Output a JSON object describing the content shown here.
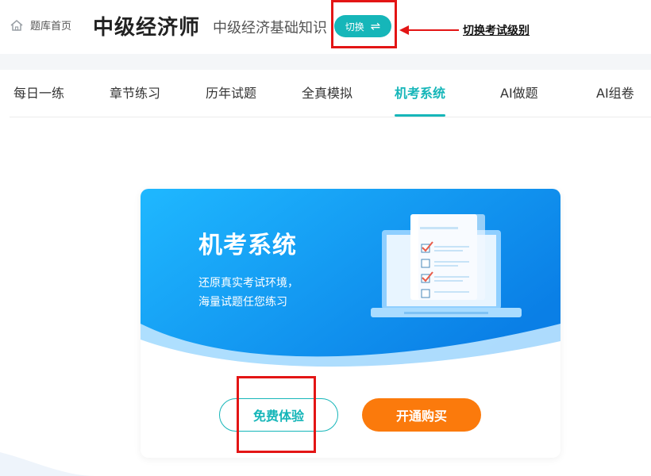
{
  "header": {
    "home_label": "题库首页",
    "exam_title": "中级经济师",
    "subject": "中级经济基础知识",
    "switch_label": "切换",
    "switch_icon": "⇌"
  },
  "annotation": {
    "switch_note": "切换考试级别"
  },
  "tabs": [
    {
      "label": "每日一练"
    },
    {
      "label": "章节练习"
    },
    {
      "label": "历年试题"
    },
    {
      "label": "全真模拟"
    },
    {
      "label": "机考系统",
      "active": true
    },
    {
      "label": "AI做题"
    },
    {
      "label": "AI组卷"
    }
  ],
  "card": {
    "title": "机考系统",
    "desc_line1": "还原真实考试环境，",
    "desc_line2": "海量试题任您练习",
    "free_button": "免费体验",
    "buy_button": "开通购买"
  },
  "colors": {
    "accent": "#16b6b9",
    "buy": "#fb7a0c",
    "annotation_red": "#e31515"
  },
  "icons": {
    "home": "home-icon",
    "switch": "switch-arrows-icon",
    "laptop": "laptop-checklist-icon"
  }
}
